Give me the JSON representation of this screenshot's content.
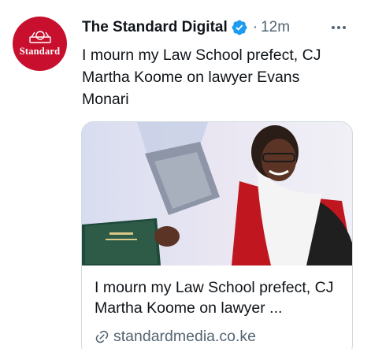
{
  "account": {
    "avatar_wordmark": "Standard",
    "name": "The Standard Digital",
    "verified_icon": "verified-badge-icon",
    "separator": "·",
    "time": "12m"
  },
  "tweet": {
    "text": "I mourn my Law School prefect, CJ Martha Koome on lawyer Evans Monari"
  },
  "link_card": {
    "title": "I mourn my Law School prefect, CJ Martha Koome on lawyer ...",
    "domain": "standardmedia.co.ke",
    "domain_icon": "link-icon"
  },
  "colors": {
    "brand_red": "#c8102e",
    "verified_blue": "#1d9bf0",
    "secondary_text": "#536471",
    "border": "#cfd9de"
  }
}
